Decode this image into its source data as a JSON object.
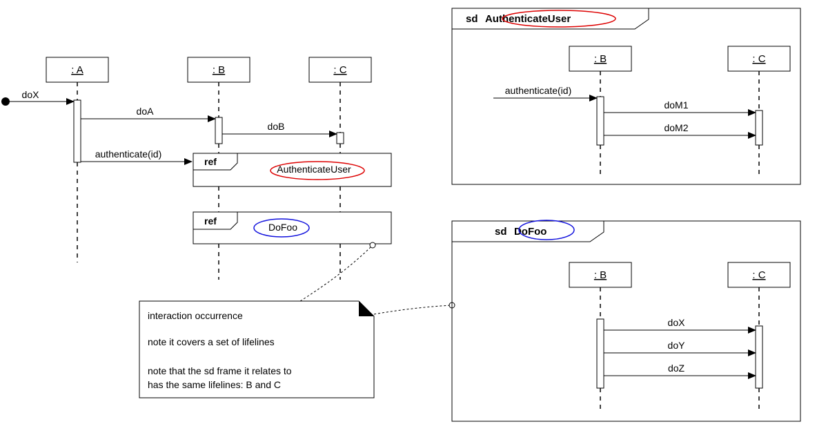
{
  "main": {
    "lifelines": {
      "a": ": A",
      "b": ": B",
      "c": ": C"
    },
    "messages": {
      "doX": "doX",
      "doA": "doA",
      "doB": "doB",
      "auth": "authenticate(id)"
    },
    "refs": {
      "ref_label": "ref",
      "auth_name": "AuthenticateUser",
      "dofoo_name": "DoFoo"
    },
    "note": {
      "line1": "interaction occurrence",
      "line2": "note it covers a set of lifelines",
      "line3a": "note that the sd frame it relates to",
      "line3b": "has the same lifelines: B and C"
    }
  },
  "sd_auth": {
    "title_prefix": "sd",
    "title_name": "AuthenticateUser",
    "lifelines": {
      "b": ": B",
      "c": ": C"
    },
    "messages": {
      "auth_in": "authenticate(id)",
      "doM1": "doM1",
      "doM2": "doM2"
    }
  },
  "sd_dofoo": {
    "title_prefix": "sd",
    "title_name": "DoFoo",
    "lifelines": {
      "b": ": B",
      "c": ": C"
    },
    "messages": {
      "doX": "doX",
      "doY": "doY",
      "doZ": "doZ"
    }
  }
}
